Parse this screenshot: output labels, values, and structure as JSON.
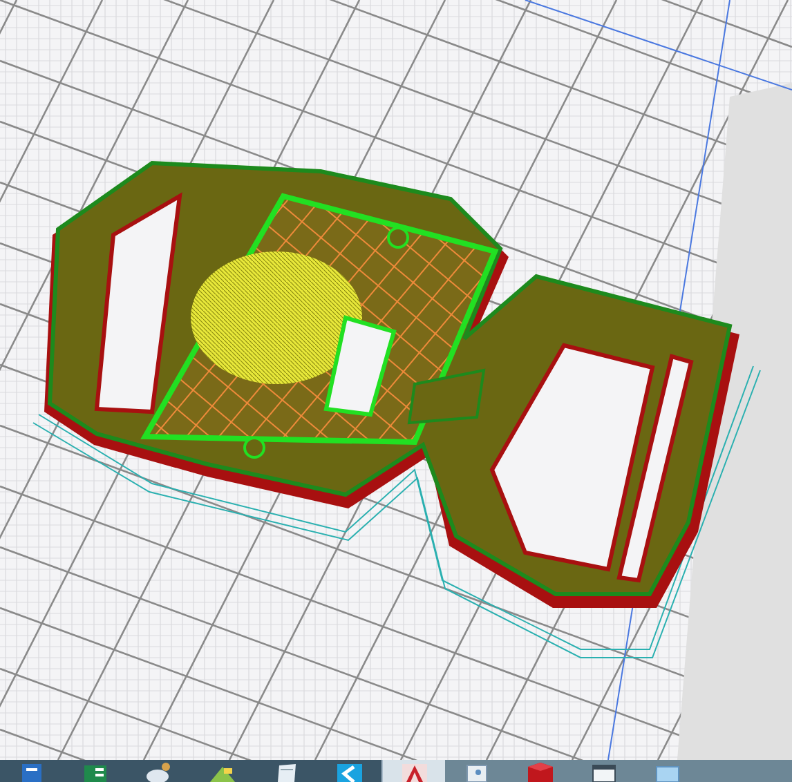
{
  "taskbar": {
    "apps": [
      {
        "kind": "document",
        "selected": false
      },
      {
        "kind": "spreadsheet",
        "selected": false
      },
      {
        "kind": "paint",
        "selected": false
      },
      {
        "kind": "photos",
        "selected": false
      },
      {
        "kind": "notepad",
        "selected": false
      },
      {
        "kind": "arrow",
        "selected": false
      },
      {
        "kind": "cad",
        "selected": true
      },
      {
        "kind": "picture",
        "selected": false
      },
      {
        "kind": "cube",
        "selected": false
      },
      {
        "kind": "window",
        "selected": false
      },
      {
        "kind": "monitor",
        "selected": false
      }
    ]
  }
}
